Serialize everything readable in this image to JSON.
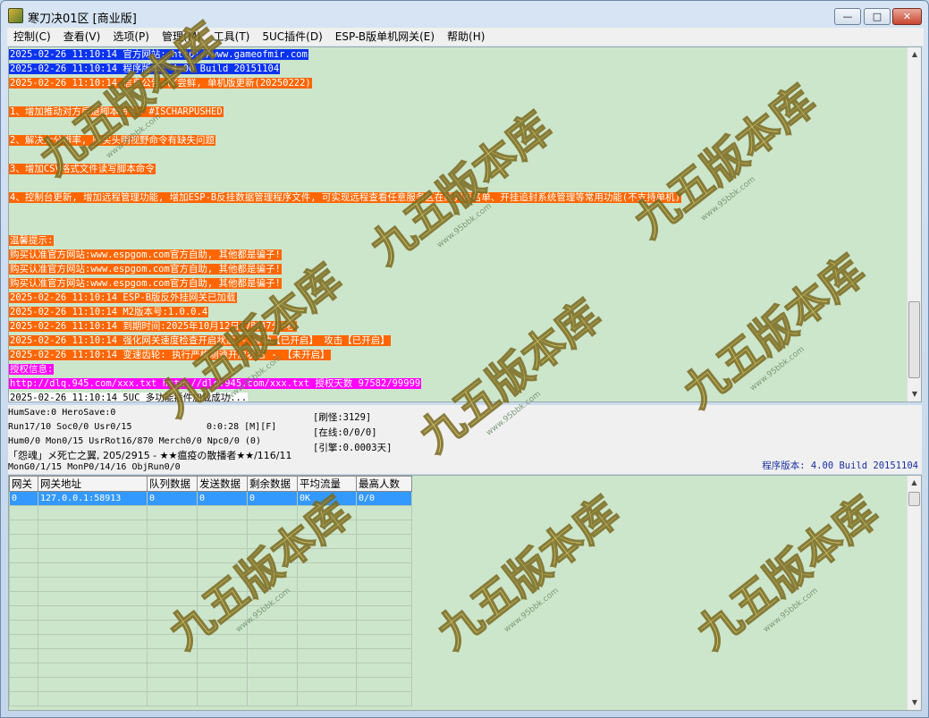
{
  "window": {
    "title": "寒刀决01区 [商业版]",
    "min_glyph": "—",
    "max_glyph": "□",
    "close_glyph": "✕"
  },
  "menu": [
    "控制(C)",
    "查看(V)",
    "选项(P)",
    "管理(M)",
    "工具(T)",
    "5UC插件(D)",
    "ESP-B版单机网关(E)",
    "帮助(H)"
  ],
  "log": [
    {
      "style": "blue",
      "text": "2025-02-26 11:10:14 官方网站: http://www.gameofmir.com"
    },
    {
      "style": "blue",
      "text": "2025-02-26 11:10:14 程序版本: 4.00 Build 20151104"
    },
    {
      "style": "orange",
      "text": "2025-02-26 11:10:14 信息公告:(K尝鲜, 单机版更新(20250222)"
    },
    {
      "style": "gap",
      "text": ""
    },
    {
      "style": "orange",
      "text": "1、增加推动对方后退脚本命令: #ISCHARPUSHED"
    },
    {
      "style": "gap",
      "text": ""
    },
    {
      "style": "orange",
      "text": "2、解决大分辨率, 购买头明视野命令有缺失问题"
    },
    {
      "style": "gap",
      "text": ""
    },
    {
      "style": "orange",
      "text": "3、增加CSV格式文件读写脚本命令"
    },
    {
      "style": "gap",
      "text": ""
    },
    {
      "style": "orange",
      "text": "4、控制台更新, 增加远程管理功能, 增加ESP-B反挂数据管理程序文件, 可实现远程查看任意服务区在线列表名单、开挂追封系统管理等常用功能(不支持单机)"
    },
    {
      "style": "gap",
      "text": ""
    },
    {
      "style": "gap",
      "text": ""
    },
    {
      "style": "orange",
      "text": "温馨提示:"
    },
    {
      "style": "orange",
      "text": "购买认准官方网站:www.espgom.com官方自助, 其他都是骗子!"
    },
    {
      "style": "orange",
      "text": "购买认准官方网站:www.espgom.com官方自助, 其他都是骗子!"
    },
    {
      "style": "orange",
      "text": "购买认准官方网站:www.espgom.com官方自助, 其他都是骗子!"
    },
    {
      "style": "orange",
      "text": "2025-02-26 11:10:14 ESP-B版反外挂网关已加载"
    },
    {
      "style": "orange",
      "text": "2025-02-26 11:10:14 M2版本号:1.0.0.4"
    },
    {
      "style": "orange",
      "text": "2025-02-26 11:10:14 到期时间:2025年10月12日17时47分6秒"
    },
    {
      "style": "orange",
      "text": "2025-02-26 11:10:14 强化网关速度检查开启状态 - 移动【已开启】 攻击【已开启】"
    },
    {
      "style": "orange",
      "text": "2025-02-26 11:10:14 变速齿轮: 执行严格测速开启状态 - 【未开启】"
    },
    {
      "style": "magenta",
      "text": "授权信息:"
    },
    {
      "style": "magenta",
      "text": "http://dlq.945.com/xxx.txt http://dlq.945.com/xxx.txt 授权天数 97582/99999"
    },
    {
      "style": "white",
      "text": "2025-02-26 11:10:14 5UC 多功能插件加载成功..."
    }
  ],
  "status": {
    "line1": "HumSave:0 HeroSave:0",
    "line2": "Run17/10 Soc0/0 Usr0/15",
    "time": "0:0:28 [M][F]",
    "line3": "Hum0/0 Mon0/15 UsrRot16/870 Merch0/0 Npc0/0 (0)",
    "line4": "「怨魂」メ死亡之翼, 205/2915 - ★★瘟疫の散播者★★/116/11",
    "line5": "MonG0/1/15 MonP0/14/16 ObjRun0/0",
    "refresh": "[刷怪:3129]",
    "online": "[在线:0/0/0]",
    "engine": "[引擎:0.0003天]",
    "version": "程序版本: 4.00 Build 20151104"
  },
  "grid": {
    "headers": [
      "网关",
      "网关地址",
      "队列数据",
      "发送数据",
      "剩余数据",
      "平均流量",
      "最高人数"
    ],
    "rows": [
      [
        "0",
        "127.0.0.1:58913",
        "0",
        "0",
        "0",
        "0K",
        "0/0"
      ]
    ]
  },
  "watermark": {
    "text": "九五版本库",
    "sub": "www.95bbk.com"
  }
}
